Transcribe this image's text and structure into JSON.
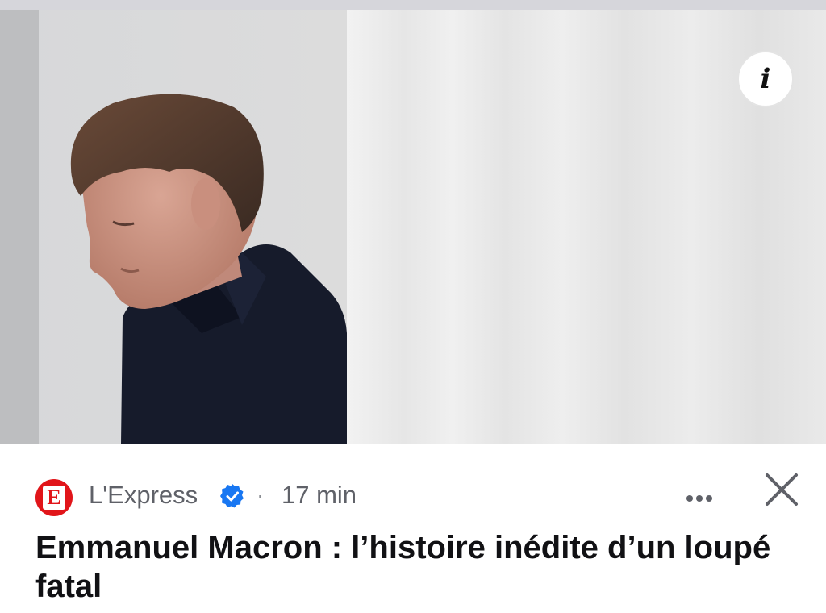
{
  "article": {
    "image_alt": "Emmanuel Macron",
    "source": "L'Express",
    "source_logo_letter": "E",
    "separator": "·",
    "age": "17 min",
    "headline": "Emmanuel Macron : l’histoire inédite d’un loupé fatal"
  },
  "icons": {
    "info": "info-icon",
    "verified": "verified-badge-icon",
    "more": "more-options-icon",
    "close": "close-icon"
  },
  "info_glyph": "i",
  "colors": {
    "brand_red": "#e1151a",
    "verified_blue": "#1877f2",
    "text_primary": "#111114",
    "text_secondary": "#5f6168"
  }
}
